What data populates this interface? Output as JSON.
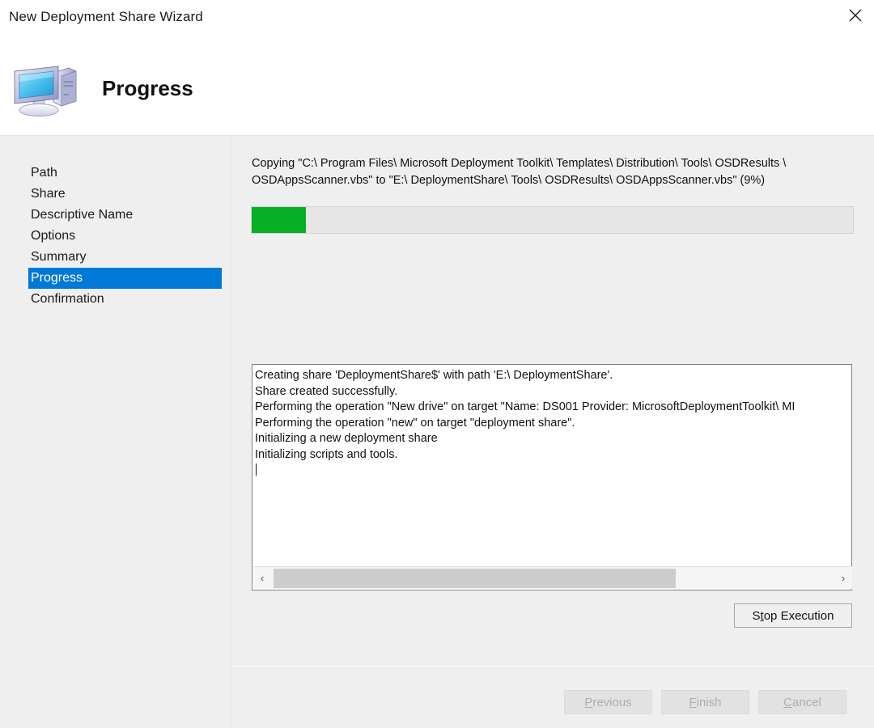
{
  "window": {
    "title": "New Deployment Share Wizard",
    "close_icon": "close-icon"
  },
  "header": {
    "icon": "computer-icon",
    "title": "Progress"
  },
  "sidebar": {
    "items": [
      {
        "label": "Path",
        "selected": false
      },
      {
        "label": "Share",
        "selected": false
      },
      {
        "label": "Descriptive Name",
        "selected": false
      },
      {
        "label": "Options",
        "selected": false
      },
      {
        "label": "Summary",
        "selected": false
      },
      {
        "label": "Progress",
        "selected": true
      },
      {
        "label": "Confirmation",
        "selected": false
      }
    ],
    "selected_color": "#0078d7"
  },
  "main": {
    "status_text": "Copying \"C:\\ Program Files\\ Microsoft Deployment Toolkit\\ Templates\\ Distribution\\ Tools\\ OSDResults \\ OSDAppsScanner.vbs\" to \"E:\\ DeploymentShare\\ Tools\\ OSDResults\\ OSDAppsScanner.vbs\" (9%)",
    "progress": {
      "percent": 9,
      "percent_label": "9%",
      "fill_color": "#06b025",
      "track_color": "#e6e6e6"
    },
    "log_lines": [
      "Creating share 'DeploymentShare$' with path 'E:\\ DeploymentShare'.",
      "Share created successfully.",
      "Performing the operation \"New drive\" on target \"Name: DS001 Provider: MicrosoftDeploymentToolkit\\ MI",
      "Performing the operation \"new\" on target \"deployment share\".",
      "Initializing a new deployment share",
      "Initializing scripts and tools."
    ],
    "scrollbar": {
      "left_icon": "chevron-left-icon",
      "left_glyph": "‹",
      "right_icon": "chevron-right-icon",
      "right_glyph": "›"
    },
    "stop_button": {
      "prefix": "S",
      "accel": "t",
      "suffix": "op Execution",
      "label": "Stop Execution"
    }
  },
  "footer": {
    "buttons": [
      {
        "accel": "P",
        "rest": "revious",
        "label": "Previous",
        "enabled": false
      },
      {
        "accel": "F",
        "rest": "inish",
        "label": "Finish",
        "enabled": false
      },
      {
        "accel": "C",
        "rest": "ancel",
        "label": "Cancel",
        "enabled": false
      }
    ]
  }
}
